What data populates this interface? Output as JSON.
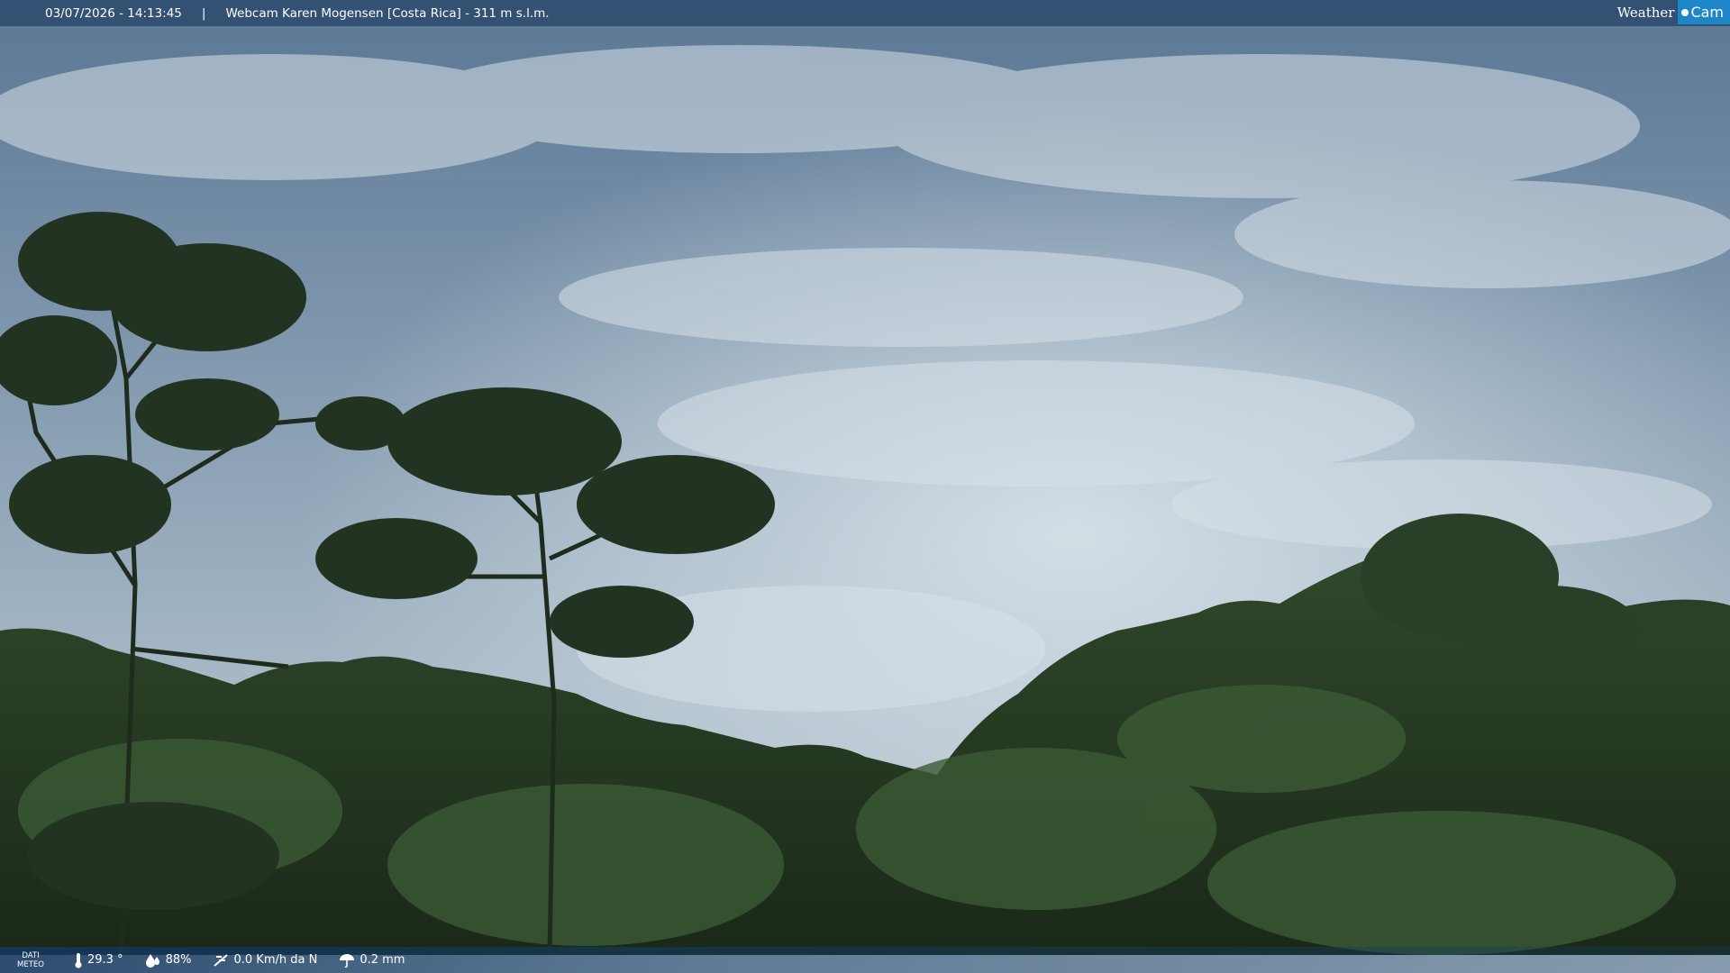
{
  "header": {
    "datetime": "03/07/2026 - 14:13:45",
    "separator": "|",
    "title": "Webcam Karen Mogensen [Costa Rica]  - 311 m s.l.m.",
    "logo_word": "Weather",
    "logo_cam": "Cam"
  },
  "footer": {
    "dati_line1": "DATI",
    "dati_line2": "METEO",
    "temperature": "29.3 °",
    "humidity": "88%",
    "wind": "0.0 Km/h da N",
    "rain": "0.2 mm",
    "icons": [
      "thermometer-icon",
      "humidity-drop-icon",
      "wind-icon",
      "rain-umbrella-icon"
    ]
  },
  "colors": {
    "sky_top": "#5f7b98",
    "sky_light": "#c9d5de",
    "forest_dark": "#1d2e1c",
    "forest_mid": "#2f4a2b",
    "logo_blue": "#1d86c8"
  }
}
